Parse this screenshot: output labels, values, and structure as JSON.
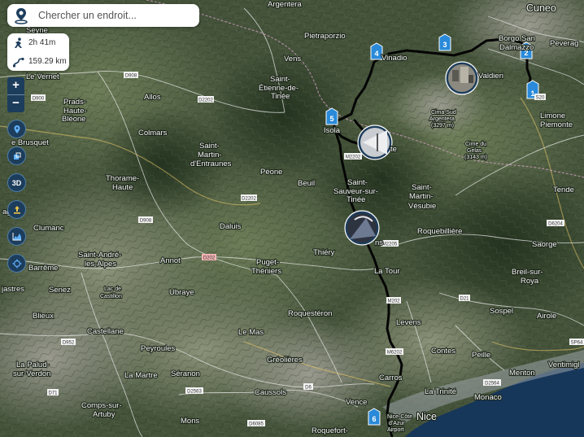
{
  "search": {
    "placeholder": "Chercher un endroit..."
  },
  "stats": {
    "duration": "2h 41m",
    "distance": "159.29 km"
  },
  "controls": {
    "zoom_in": "+",
    "zoom_out": "−",
    "mode_3d": "3D"
  },
  "places": {
    "cuneo": "Cuneo",
    "argentera": "Argentera",
    "seyne": "Seyne",
    "pietraporzio": "Pietraporzio",
    "vens": "Vens",
    "vinadio": "Vinadio",
    "borgo": "Borgo San",
    "dalmazzo": "Dalmazzo",
    "peveragno": "Peverag",
    "le_vernet": "Le Vernet",
    "prads1": "Prads-",
    "prads2": "Haute-",
    "prads3": "Bléone",
    "allos": "Allos",
    "saint_etienne1": "Saint-",
    "saint_etienne2": "Étienne-de-",
    "saint_etienne3": "Tinée",
    "valdieri": "Valdieri",
    "limone1": "Limone",
    "limone2": "Piemonte",
    "cima1": "Cima Sud",
    "cima2": "Argentera",
    "cima3": "(3297 m)",
    "gelas1": "Cime du",
    "gelas2": "Gelas",
    "gelas3": "(3143 m)",
    "colmars": "Colmars",
    "brusquet": "e Brusquet",
    "isola": "Isola",
    "isola_frag": "te",
    "martin_ent1": "Saint-",
    "martin_ent2": "Martin-",
    "martin_ent3": "d'Entraunes",
    "tende": "Tende",
    "thorame1": "Thorame-",
    "thorame2": "Haute",
    "peone": "Péone",
    "beuil": "Beuil",
    "sauveur1": "Saint-",
    "sauveur2": "Sauveur-sur-",
    "sauveur3": "Tinée",
    "vesubie1": "Saint-",
    "vesubie2": "Martin-",
    "vesubie3": "Vésubie",
    "clumanc": "Clumanc",
    "ages": "ages",
    "dalus": "Daluis",
    "roquebilliere": "Roquebillière",
    "saorge": "Saorge",
    "saint_andre1": "Saint-André-",
    "saint_andre2": "les-Alpes",
    "barreme": "Barrême",
    "annot": "Annot",
    "puget1": "Puget-",
    "puget2": "Théniers",
    "thiery": "Thiéry",
    "ns_frag": "ns",
    "la_tour": "La Tour",
    "breil1": "Breil-sur-",
    "breil2": "Roya",
    "senez": "Senez",
    "lac1": "Lac de",
    "lac2": "Castillon",
    "ubraye": "Ubraye",
    "jastres": "jastres",
    "blieux": "Blieux",
    "roquesteron": "Roquestéron",
    "sospel": "Sospel",
    "airole": "Airole",
    "levens": "Levens",
    "castellane": "Castellane",
    "le_mas": "Le Mas",
    "peyroules": "Peyroules",
    "contes": "Contes",
    "peille": "Peille",
    "greolieres": "Gréolières",
    "menton": "Menton",
    "ventimiglia": "Ventimigl",
    "palud1": "La Palud-",
    "palud2": "sur-Verdon",
    "la_martre": "La Martre",
    "seranon": "Séranon",
    "carros": "Carros",
    "la_trinite": "La Trinité",
    "caussols": "Caussols",
    "monaco": "Monaco",
    "comps1": "Comps-sur-",
    "comps2": "Artuby",
    "vence": "Vence",
    "nice": "Nice",
    "airport1": "Nice-Côte",
    "airport2": "d'Azur",
    "airport3": "Airport",
    "mons": "Mons",
    "roquefort": "Roquefort-"
  },
  "roads": {
    "d908a": "D908",
    "d900": "D900",
    "d2202a": "D2202",
    "d2202b": "D2202",
    "d908b": "D908",
    "d202": "D202",
    "m202a": "M2202",
    "m2205": "M2205",
    "d6204": "D6204",
    "d21": "D21",
    "m202b": "M202",
    "d952": "D952",
    "m6202": "M6202",
    "d6": "D6",
    "d2564": "D2564",
    "sp64": "SP64",
    "d71": "D71",
    "d2563": "D2563",
    "d6085": "D6085",
    "s20": "S20"
  },
  "waypoints": [
    "1",
    "2",
    "3",
    "4",
    "5",
    "6"
  ],
  "colors": {
    "route": "#050505",
    "waypoint": "#2a8ad9",
    "control": "#1d3d5c",
    "sea": "#16365a"
  }
}
